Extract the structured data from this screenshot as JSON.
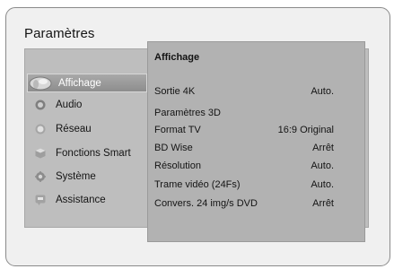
{
  "header": {
    "title": "Paramètres"
  },
  "menu": {
    "items": [
      {
        "label": "Affichage",
        "icon": "display-icon",
        "selected": true
      },
      {
        "label": "Audio",
        "icon": "speaker-icon"
      },
      {
        "label": "Réseau",
        "icon": "network-icon"
      },
      {
        "label": "Fonctions Smart",
        "icon": "smart-cube-icon"
      },
      {
        "label": "Système",
        "icon": "gear-icon"
      },
      {
        "label": "Assistance",
        "icon": "help-icon"
      }
    ]
  },
  "submenu": {
    "title": "Affichage",
    "rows": [
      {
        "label": "Sortie 4K",
        "value": "Auto."
      },
      {
        "label": "Paramètres 3D",
        "value": ""
      },
      {
        "label": "Format TV",
        "value": "16:9 Original"
      },
      {
        "label": "BD Wise",
        "value": "Arrêt"
      },
      {
        "label": "Résolution",
        "value": "Auto."
      },
      {
        "label": "Trame vidéo (24Fs)",
        "value": "Auto."
      },
      {
        "label": "Convers. 24 img/s DVD",
        "value": "Arrêt"
      }
    ]
  }
}
